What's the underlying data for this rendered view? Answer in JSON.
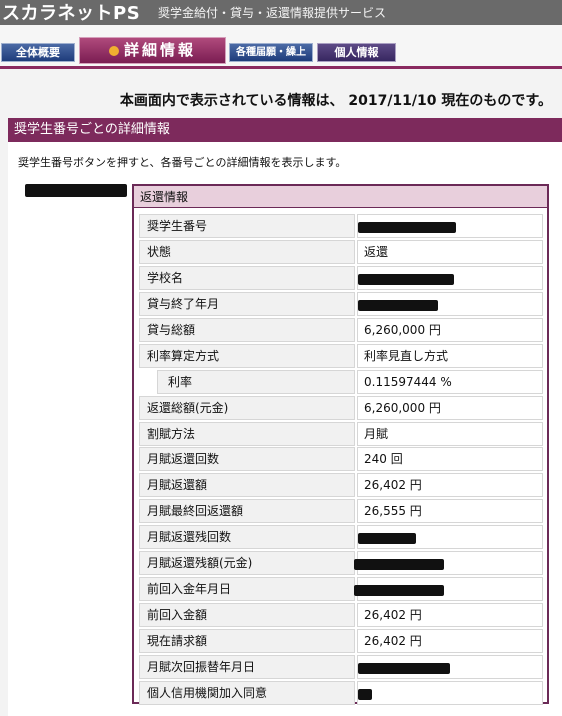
{
  "header": {
    "brand": "スカラネットPS",
    "subtitle": "奨学金給付・貸与・返還情報提供サービス"
  },
  "tabs": [
    {
      "label": "全体概要"
    },
    {
      "label": "詳細情報",
      "active": true
    },
    {
      "label": "各種届願・繰上"
    },
    {
      "label": "個人情報"
    }
  ],
  "notice": "本画面内で表示されている情報は、 2017/11/10 現在のものです。",
  "section": {
    "title": "奨学生番号ごとの詳細情報",
    "description": "奨学生番号ボタンを押すと、各番号ごとの詳細情報を表示します。"
  },
  "detail": {
    "heading": "返還情報",
    "rows": [
      {
        "label": "奨学生番号",
        "value": ""
      },
      {
        "label": "状態",
        "value": "返還"
      },
      {
        "label": "学校名",
        "value": ""
      },
      {
        "label": "貸与終了年月",
        "value": ""
      },
      {
        "label": "貸与総額",
        "value": "6,260,000 円"
      },
      {
        "label": "利率算定方式",
        "value": "利率見直し方式"
      },
      {
        "label": "利率",
        "value": "0.11597444 %"
      },
      {
        "label": "返還総額(元金)",
        "value": "6,260,000 円"
      },
      {
        "label": "割賦方法",
        "value": "月賦"
      },
      {
        "label": "月賦返還回数",
        "value": "240 回"
      },
      {
        "label": "月賦返還額",
        "value": "26,402 円"
      },
      {
        "label": "月賦最終回返還額",
        "value": "26,555 円"
      },
      {
        "label": "月賦返還残回数",
        "value": ""
      },
      {
        "label": "月賦返還残額(元金)",
        "value": ""
      },
      {
        "label": "前回入金年月日",
        "value": ""
      },
      {
        "label": "前回入金額",
        "value": "26,402 円"
      },
      {
        "label": "現在請求額",
        "value": "26,402 円"
      },
      {
        "label": "月賦次回振替年月日",
        "value": ""
      },
      {
        "label": "個人信用機関加入同意",
        "value": ""
      }
    ]
  }
}
